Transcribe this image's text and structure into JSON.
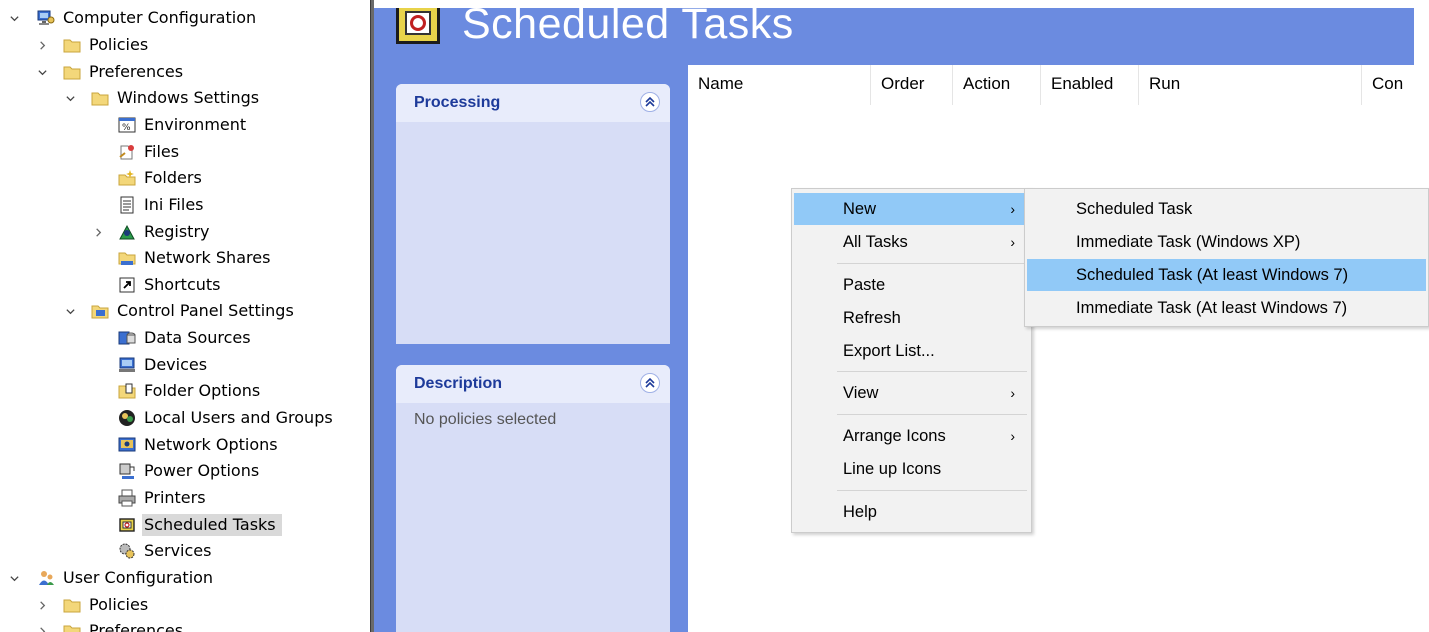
{
  "tree": {
    "items": [
      {
        "label": "Computer Configuration",
        "chevron": "expanded",
        "icon": "computer-config-icon"
      },
      {
        "label": "Policies",
        "chevron": "collapsed",
        "icon": "folder-icon"
      },
      {
        "label": "Preferences",
        "chevron": "expanded",
        "icon": "folder-icon"
      },
      {
        "label": "Windows Settings",
        "chevron": "expanded",
        "icon": "folder-icon"
      },
      {
        "label": "Environment",
        "chevron": "none",
        "icon": "environment-icon"
      },
      {
        "label": "Files",
        "chevron": "none",
        "icon": "files-icon"
      },
      {
        "label": "Folders",
        "chevron": "none",
        "icon": "folders-icon"
      },
      {
        "label": "Ini Files",
        "chevron": "none",
        "icon": "ini-files-icon"
      },
      {
        "label": "Registry",
        "chevron": "collapsed",
        "icon": "registry-icon"
      },
      {
        "label": "Network Shares",
        "chevron": "none",
        "icon": "network-shares-icon"
      },
      {
        "label": "Shortcuts",
        "chevron": "none",
        "icon": "shortcuts-icon"
      },
      {
        "label": "Control Panel Settings",
        "chevron": "expanded",
        "icon": "control-panel-icon"
      },
      {
        "label": "Data Sources",
        "chevron": "none",
        "icon": "data-sources-icon"
      },
      {
        "label": "Devices",
        "chevron": "none",
        "icon": "devices-icon"
      },
      {
        "label": "Folder Options",
        "chevron": "none",
        "icon": "folder-options-icon"
      },
      {
        "label": "Local Users and Groups",
        "chevron": "none",
        "icon": "local-users-icon"
      },
      {
        "label": "Network Options",
        "chevron": "none",
        "icon": "network-options-icon"
      },
      {
        "label": "Power Options",
        "chevron": "none",
        "icon": "power-options-icon"
      },
      {
        "label": "Printers",
        "chevron": "none",
        "icon": "printers-icon"
      },
      {
        "label": "Scheduled Tasks",
        "chevron": "none",
        "icon": "scheduled-tasks-icon",
        "selected": true
      },
      {
        "label": "Services",
        "chevron": "none",
        "icon": "services-icon"
      },
      {
        "label": "User Configuration",
        "chevron": "expanded",
        "icon": "user-config-icon"
      },
      {
        "label": "Policies",
        "chevron": "collapsed",
        "icon": "folder-icon"
      },
      {
        "label": "Preferences",
        "chevron": "collapsed",
        "icon": "folder-icon"
      }
    ]
  },
  "taskpad": {
    "title": "Scheduled Tasks",
    "icon": "scheduled-tasks-large-icon",
    "processing": {
      "title": "Processing"
    },
    "description": {
      "title": "Description",
      "text": "No policies selected"
    },
    "columns": [
      "Name",
      "Order",
      "Action",
      "Enabled",
      "Run",
      "Con"
    ]
  },
  "context_menu": {
    "items": [
      {
        "label": "New",
        "submenu": true,
        "highlighted": true
      },
      {
        "label": "All Tasks",
        "submenu": true
      },
      {
        "label": "Paste",
        "submenu": false
      },
      {
        "label": "Refresh",
        "submenu": false
      },
      {
        "label": "Export List...",
        "submenu": false
      },
      {
        "label": "View",
        "submenu": true
      },
      {
        "label": "Arrange Icons",
        "submenu": true
      },
      {
        "label": "Line up Icons",
        "submenu": false
      },
      {
        "label": "Help",
        "submenu": false
      }
    ],
    "submenu_arrow": "›"
  },
  "new_submenu": {
    "items": [
      {
        "label": "Scheduled Task"
      },
      {
        "label": "Immediate Task (Windows XP)"
      },
      {
        "label": "Scheduled Task (At least Windows 7)",
        "highlighted": true
      },
      {
        "label": "Immediate Task (At least Windows 7)"
      }
    ]
  },
  "colors": {
    "taskpad_bg": "#6b8be0",
    "panel_bg": "#d7ddf6",
    "panel_title": "#1d3a9a",
    "menu_highlight": "#91c9f7",
    "menu_bg": "#f2f2f2",
    "selection_bg": "#d9d9d9"
  }
}
